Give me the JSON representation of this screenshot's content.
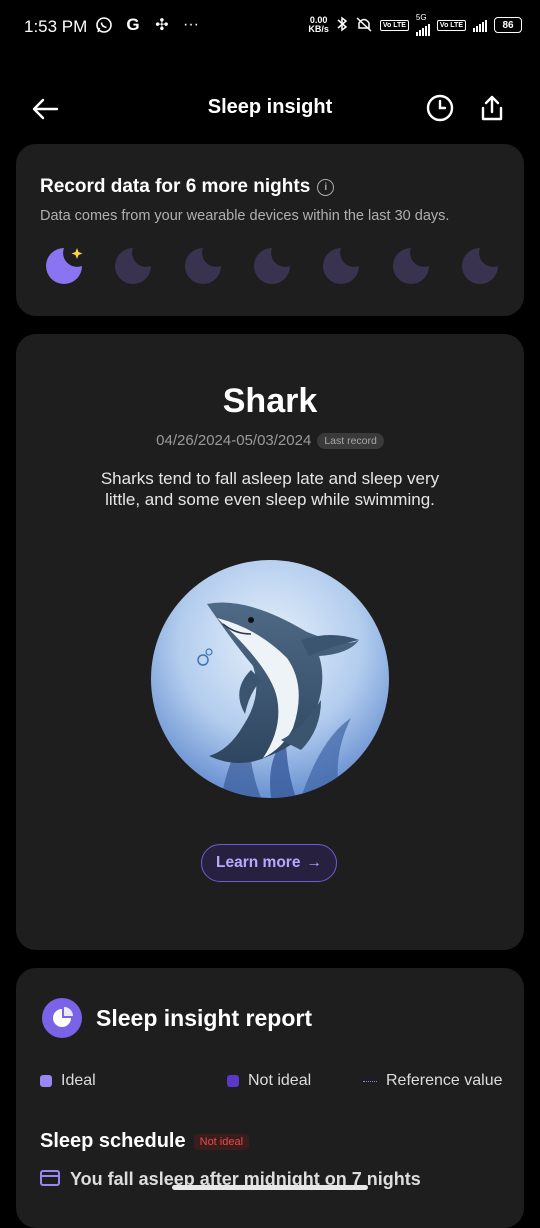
{
  "status_bar": {
    "time": "1:53 PM",
    "left_icons": [
      "whatsapp-icon",
      "google-icon",
      "pinwheel-icon",
      "more-dots-icon"
    ],
    "net_speed_value": "0.00",
    "net_speed_unit": "KB/s",
    "volte_label": "Vo LTE",
    "network_label": "5G",
    "battery": "86"
  },
  "header": {
    "title": "Sleep insight"
  },
  "record_card": {
    "title": "Record data for 6 more nights",
    "subtitle": "Data comes from your wearable devices within the last 30 days.",
    "nights_recorded": 1,
    "nights_total": 7
  },
  "animal_card": {
    "name": "Shark",
    "date_range": "04/26/2024-05/03/2024",
    "badge": "Last record",
    "description": "Sharks tend to fall asleep late and sleep very little, and some even sleep while swimming.",
    "learn_more": "Learn more",
    "learn_more_arrow": "→"
  },
  "report_card": {
    "title": "Sleep insight report",
    "legend": {
      "ideal": "Ideal",
      "not_ideal": "Not ideal",
      "reference": "Reference value"
    },
    "section_title": "Sleep schedule",
    "section_badge": "Not ideal",
    "first_line": "You fall asleep after midnight on 7 nights"
  },
  "colors": {
    "accent": "#7a63e6",
    "ideal": "#9a86f5",
    "not_ideal": "#5b38c8",
    "warning": "#e84b4b",
    "card_bg": "#1e1e1e"
  }
}
